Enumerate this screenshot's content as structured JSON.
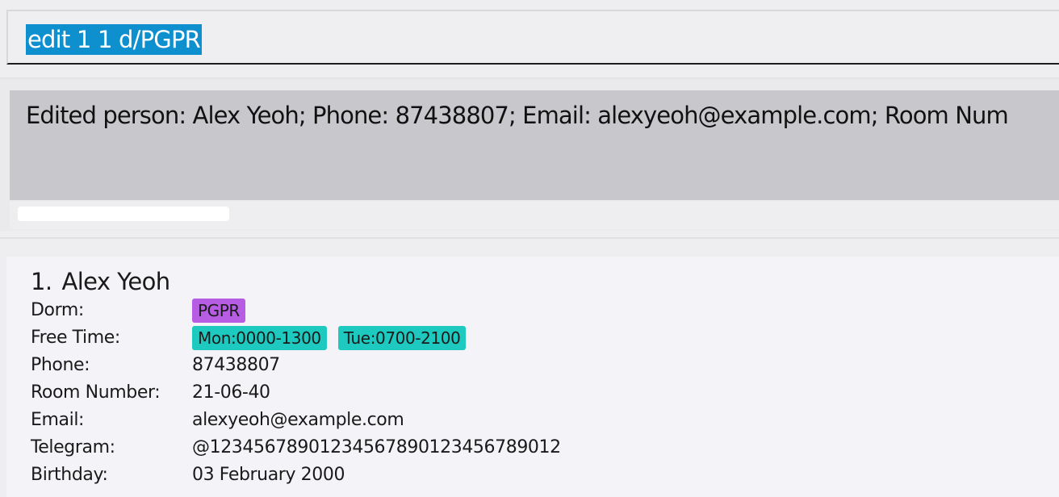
{
  "command_box": {
    "text": "edit 1 1 d/PGPR"
  },
  "result_display": {
    "text": "Edited person: Alex Yeoh; Phone: 87438807; Email: alexyeoh@example.com; Room Num"
  },
  "person_list": [
    {
      "index": "1.",
      "name": "Alex Yeoh",
      "dorm_label": "Dorm:",
      "dorm": "PGPR",
      "free_time_label": "Free Time:",
      "free_times": [
        "Mon:0000-1300",
        "Tue:0700-2100"
      ],
      "phone_label": "Phone:",
      "phone": "87438807",
      "room_label": "Room Number:",
      "room": "21-06-40",
      "email_label": "Email:",
      "email": "alexyeoh@example.com",
      "telegram_label": "Telegram:",
      "telegram": "@12345678901234567890123456789012",
      "birthday_label": "Birthday:",
      "birthday": "03 February 2000"
    }
  ],
  "colors": {
    "selection": "#0e8fce",
    "dorm_tag": "#b65de3",
    "free_time_tag": "#1ec9c0",
    "result_background": "#c8c8cc"
  }
}
